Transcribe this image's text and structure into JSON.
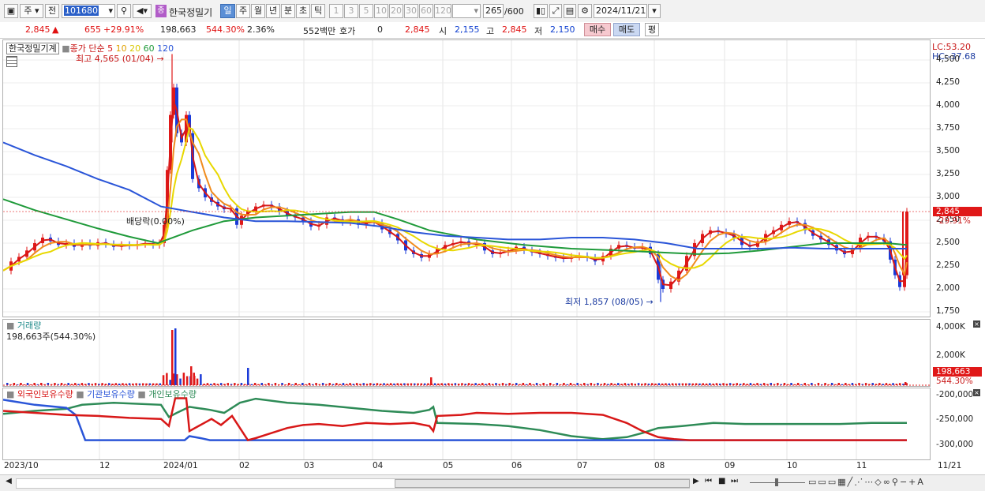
{
  "toolbar": {
    "mode_label": "주",
    "prev_label": "전",
    "stock_code": "101680",
    "stock_badge": "종",
    "stock_name": "한국정밀기",
    "period_tabs": [
      "일",
      "주",
      "월",
      "년",
      "분",
      "초",
      "틱"
    ],
    "active_period": "일",
    "interval_buttons": [
      "1",
      "3",
      "5",
      "10",
      "20",
      "30",
      "60",
      "120"
    ],
    "count_value": "265",
    "count_total": "/600",
    "date_value": "2024/11/21"
  },
  "quote": {
    "price": "2,845",
    "change": "655",
    "change_pct": "+29.91%",
    "volume": "198,663",
    "volume_ratio": "544.30%",
    "turnover": "2.36%",
    "amount": "552백만",
    "hoga_label": "호가",
    "hoga_value": "0",
    "hoga_price": "2,845",
    "open_label": "시",
    "open_value": "2,155",
    "high_label": "고",
    "high_value": "2,845",
    "low_label": "저",
    "low_value": "2,150",
    "buy_label": "매수",
    "sell_label": "매도",
    "avg_label": "평"
  },
  "price_panel": {
    "stock_label": "한국정밀기계",
    "ma_label": "종가 단순",
    "ma_periods": [
      "5",
      "10",
      "20",
      "60",
      "120"
    ],
    "ma_colors": [
      "#d81818",
      "#f08c1e",
      "#e8d800",
      "#1f9a3a",
      "#2a55d8"
    ],
    "lc_label": "LC:53.20",
    "hc_label": "HC:-37.68",
    "high_annotation": "최고 4,565 (01/04)",
    "low_annotation": "최저 1,857 (08/05)",
    "dividend_annotation": "배당락(0.00%)",
    "current_price_tag": "2,845",
    "current_pct_tag": "29.91%",
    "y_ticks": [
      "4,500",
      "4,250",
      "4,000",
      "3,750",
      "3,500",
      "3,250",
      "3,000",
      "2,750",
      "2,500",
      "2,250",
      "2,000",
      "1,750"
    ]
  },
  "volume_panel": {
    "title": "거래량",
    "subtitle": "198,663주(544.30%)",
    "y_ticks": [
      "4,000K",
      "2,000K"
    ],
    "current_tag": "198,663",
    "current_pct": "544.30%"
  },
  "holdings_panel": {
    "legend": [
      "외국인보유수량",
      "기관보유수량",
      "개인보유수량"
    ],
    "legend_colors": [
      "#d81818",
      "#2a55d8",
      "#2e8b57"
    ],
    "y_ticks": [
      "-200,000",
      "-250,000",
      "-300,000"
    ]
  },
  "x_axis": {
    "labels": [
      "2023/10",
      "12",
      "2024/01",
      "02",
      "03",
      "04",
      "05",
      "06",
      "07",
      "08",
      "09",
      "10",
      "11"
    ],
    "right_label": "11/21"
  },
  "chart_data": [
    {
      "type": "line",
      "title": "",
      "series_names": [
        "5",
        "10",
        "20",
        "60",
        "120"
      ],
      "y_range": [
        1750,
        4565
      ],
      "x_labels": [
        "2023/10",
        "12",
        "2024/01",
        "02",
        "03",
        "04",
        "05",
        "06",
        "07",
        "08",
        "09",
        "10",
        "11"
      ],
      "annotations": [
        "최고 4,565 (01/04)",
        "최저 1,857 (08/05)",
        "배당락(0.00%)"
      ],
      "last_close": 2845,
      "day_high": 2845,
      "day_low": 2150,
      "day_open": 2155
    }
  ]
}
